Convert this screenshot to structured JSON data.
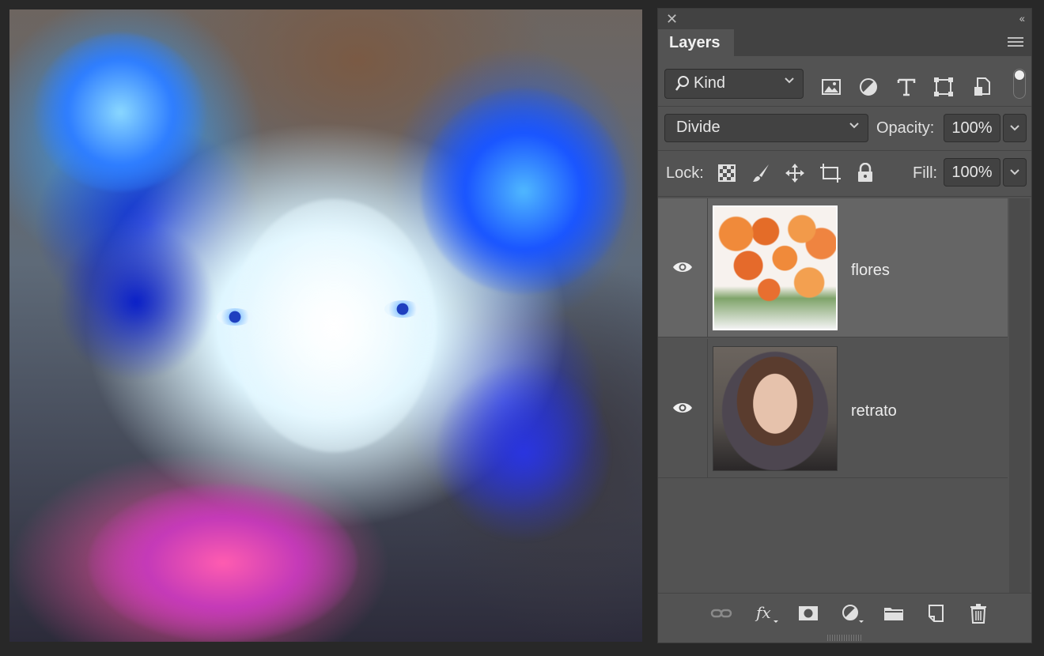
{
  "panel": {
    "title_tab": "Layers",
    "filter": {
      "kind_label": "Kind"
    },
    "blend_mode": "Divide",
    "opacity": {
      "label": "Opacity:",
      "value": "100%"
    },
    "lock": {
      "label": "Lock:"
    },
    "fill": {
      "label": "Fill:",
      "value": "100%"
    },
    "layers": [
      {
        "name": "flores",
        "visible": true,
        "selected": true
      },
      {
        "name": "retrato",
        "visible": true,
        "selected": false
      }
    ]
  },
  "colors": {
    "panel_bg": "#535353",
    "selected_row": "#656565",
    "app_bg": "#282828"
  }
}
